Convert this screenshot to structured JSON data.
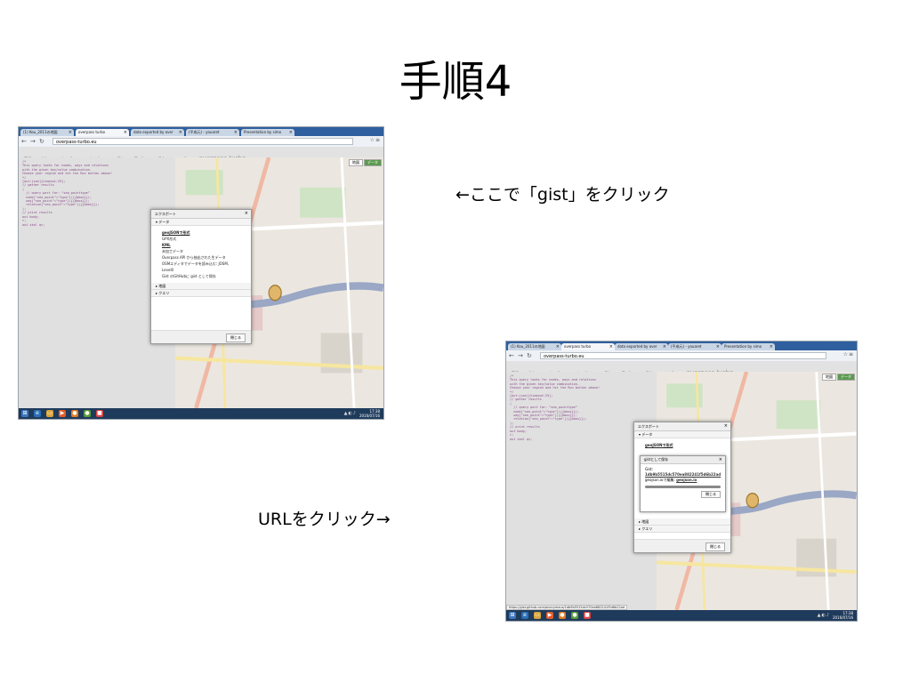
{
  "slide": {
    "title": "手順4",
    "caption_top": "←ここで「gist」をクリック",
    "caption_bottom": "URLをクリック→"
  },
  "browser": {
    "tabs": [
      "(1) Kou_2011の地図",
      "overpass turbo",
      "data exported by over",
      "(平成元) - youaret",
      "Presentation by simo"
    ],
    "url": "overpass-turbo.eu",
    "toolbar": [
      "実行",
      "共有",
      "エクスポート",
      "ウィザード",
      "保存",
      "読み込み",
      "設定",
      "ヘルプ"
    ],
    "brand": "overpass turbo",
    "map_tabs": [
      "地図",
      "データ"
    ],
    "code_lines": [
      "/*",
      "This query looks for nodes, ways and relations",
      "with the given key/value combination.",
      "Choose your region and hit the Run button above!",
      "*/",
      "[out:json][timeout:25];",
      "// gather results",
      "(",
      "  // query part for: “seo_pointtype”",
      "  node[\"seo_point\"=\"type\"]({{bbox}});",
      "  way[\"seo_point\"=\"type\"]({{bbox}});",
      "  relation[\"seo_point\"=\"type\"]({{bbox}});",
      ");",
      "// print results",
      "out body;",
      ">;",
      "out skel qt;"
    ],
    "clock_time": "17:38",
    "clock_date": "2016/07/16"
  },
  "export_dialog": {
    "title": "エクスポート",
    "section_data": "データ",
    "items": [
      "geoJSONで形式",
      "GPX形式",
      "KML",
      "未加工データ",
      "Overpass API から抽出された生データ",
      "OSMエディタでデータを読み込む: JOSM, Level0",
      "Gist のGitHubに gist として保存"
    ],
    "section_map": "地図",
    "section_query": "クエリ",
    "close_label": "閉じる"
  },
  "gist_dialog": {
    "title": "gistとして保存",
    "label": "Gist:",
    "gist_id": "1db9b5515dc570ea882241f5d6b22ad",
    "note": "geojson.ioで編集:",
    "note_link": "geojson.io",
    "ok_label": "閉じる",
    "progress": 1.0
  },
  "status_bar_url": "https://gist.github.com/anonymous/1db9b5515dc570ea882241f5d6b22ad"
}
